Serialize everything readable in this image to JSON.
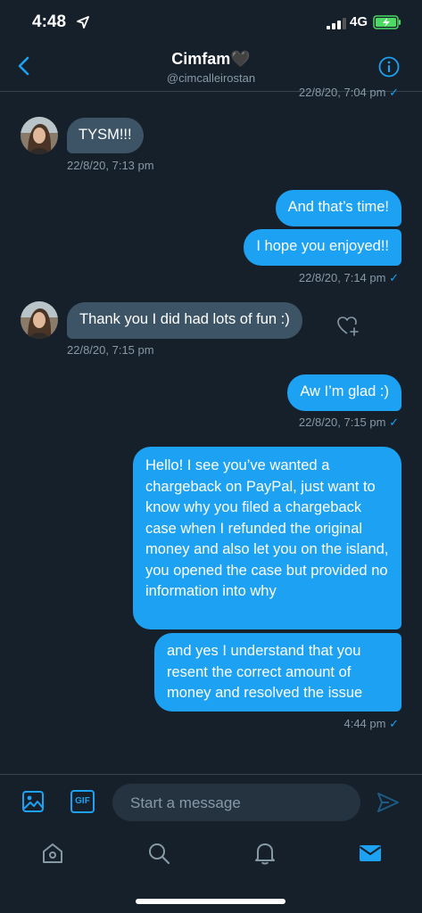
{
  "status_bar": {
    "time": "4:48",
    "network": "4G"
  },
  "header": {
    "title": "Cimfam",
    "title_emoji": "🖤",
    "handle": "@cimcalleirostan"
  },
  "messages": {
    "prev_time": "22/8/20, 7:04 pm",
    "m1": {
      "text": "TYSM!!!",
      "time": "22/8/20, 7:13 pm"
    },
    "m2": {
      "text": "And that’s time!"
    },
    "m3": {
      "text": "I hope you enjoyed!!",
      "time": "22/8/20, 7:14 pm"
    },
    "m4": {
      "text": "Thank you I did had lots of fun :)",
      "time": "22/8/20, 7:15 pm"
    },
    "m5": {
      "text": "Aw I’m glad :)",
      "time": "22/8/20, 7:15 pm"
    },
    "m6": {
      "text": "Hello! I see you’ve wanted a chargeback on PayPal, just want to know why you filed a chargeback case when I refunded the original money and also let you on the island, you opened the case but provided no information into why"
    },
    "m7": {
      "text": "and yes I understand that you resent the correct amount of money and resolved the issue",
      "time": "4:44 pm"
    },
    "check_mark": "✓"
  },
  "composer": {
    "gif_label": "GIF",
    "placeholder": "Start a message"
  },
  "colors": {
    "background": "#15202b",
    "accent": "#1da1f2",
    "received_bubble": "#3d5466",
    "muted_text": "#8899a6"
  }
}
